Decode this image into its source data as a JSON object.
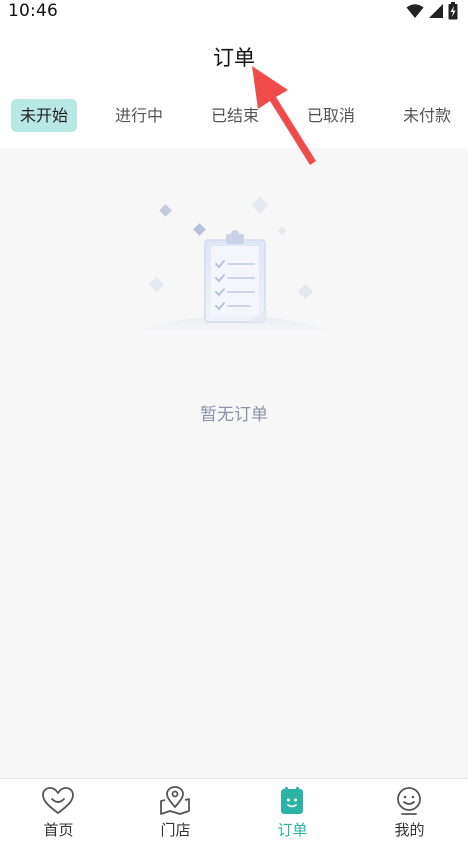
{
  "status_bar": {
    "time": "10:46"
  },
  "header": {
    "title": "订单"
  },
  "tabs": [
    {
      "label": "未开始",
      "active": true
    },
    {
      "label": "进行中",
      "active": false
    },
    {
      "label": "已结束",
      "active": false
    },
    {
      "label": "已取消",
      "active": false
    },
    {
      "label": "未付款",
      "active": false
    }
  ],
  "empty_state": {
    "message": "暂无订单",
    "icon": "clipboard-icon"
  },
  "bottom_nav": [
    {
      "label": "首页",
      "icon": "heart-face-icon",
      "active": false
    },
    {
      "label": "门店",
      "icon": "location-map-icon",
      "active": false
    },
    {
      "label": "订单",
      "icon": "order-icon",
      "active": true
    },
    {
      "label": "我的",
      "icon": "smiley-icon",
      "active": false
    }
  ],
  "colors": {
    "accent": "#2bb3a6",
    "active_tab_bg": "#b7e8e3",
    "annotation_arrow": "#f04b4b",
    "content_bg": "#f7f7f8"
  }
}
